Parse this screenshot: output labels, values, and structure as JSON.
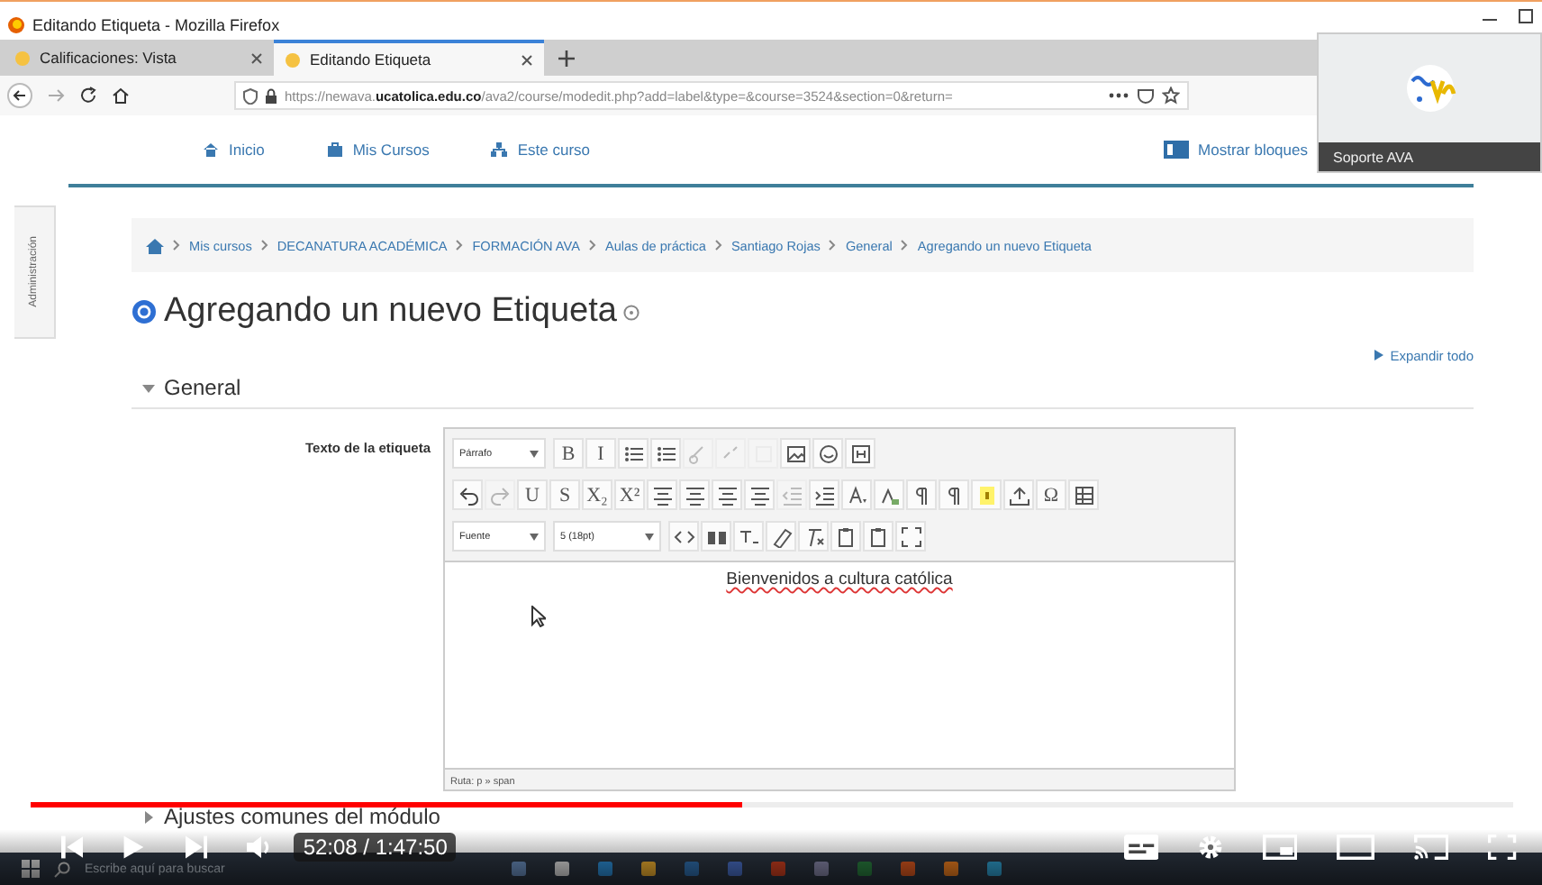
{
  "window": {
    "title": "Editando Etiqueta - Mozilla Firefox"
  },
  "tabs": [
    {
      "label": "Calificaciones: Vista",
      "selected": false
    },
    {
      "label": "Editando Etiqueta",
      "selected": true
    }
  ],
  "address_bar": {
    "url": "https://newava.**ucatolica.edu.co**/ava2/course/modedit.php?add=label&type=&course=3524&section=0&return="
  },
  "nav": {
    "items": [
      "Inicio",
      "Mis Cursos",
      "Este curso"
    ],
    "blocks_button": "Mostrar bloques"
  },
  "popup": {
    "label": "Soporte AVA"
  },
  "sidebar_tab": "Administración",
  "breadcrumb": [
    "Mis cursos",
    "DECANATURA ACADÉMICA",
    "FORMACIÓN AVA",
    "Aulas de práctica",
    "Santiago Rojas",
    "General",
    "Agregando un nuevo Etiqueta"
  ],
  "heading": "Agregando un nuevo Etiqueta",
  "expand_all": "Expandir todo",
  "section": {
    "title": "General",
    "expanded": true
  },
  "field_label": "Texto de la etiqueta",
  "editor": {
    "toolbar": [
      [
        {
          "kind": "select",
          "label": "Párrafo"
        },
        {
          "kind": "glyph",
          "text": "B",
          "disabled": false
        },
        {
          "kind": "glyph",
          "text": "I",
          "disabled": false
        },
        {
          "kind": "icon",
          "disabled": false
        },
        {
          "kind": "icon",
          "disabled": false
        },
        {
          "kind": "icon",
          "disabled": true
        },
        {
          "kind": "icon",
          "disabled": true
        },
        {
          "kind": "icon",
          "disabled": true
        },
        {
          "kind": "icon",
          "disabled": false
        },
        {
          "kind": "icon",
          "disabled": false
        },
        {
          "kind": "icon",
          "disabled": false
        }
      ],
      [
        {
          "kind": "icon",
          "disabled": false
        },
        {
          "kind": "icon",
          "disabled": true
        },
        {
          "kind": "glyph",
          "text": "U",
          "disabled": false
        },
        {
          "kind": "glyph",
          "text": "S",
          "disabled": false
        },
        {
          "kind": "glyph",
          "text": "X₂",
          "disabled": false
        },
        {
          "kind": "glyph",
          "text": "X²",
          "disabled": false
        },
        {
          "kind": "icon",
          "disabled": false
        },
        {
          "kind": "icon",
          "disabled": false
        },
        {
          "kind": "icon",
          "disabled": false
        },
        {
          "kind": "icon",
          "disabled": false
        },
        {
          "kind": "icon",
          "disabled": true
        },
        {
          "kind": "icon",
          "disabled": false
        },
        {
          "kind": "icon",
          "disabled": false
        },
        {
          "kind": "icon",
          "disabled": false
        },
        {
          "kind": "icon",
          "disabled": false
        },
        {
          "kind": "icon",
          "disabled": false
        },
        {
          "kind": "icon",
          "disabled": false
        },
        {
          "kind": "icon",
          "disabled": false
        },
        {
          "kind": "glyph",
          "text": "Ω",
          "disabled": false
        },
        {
          "kind": "icon",
          "disabled": false
        }
      ],
      [
        {
          "kind": "select",
          "label": "Fuente"
        },
        {
          "kind": "select",
          "label": "5 (18pt)"
        },
        {
          "kind": "icon",
          "disabled": false
        },
        {
          "kind": "icon",
          "disabled": false
        },
        {
          "kind": "icon",
          "disabled": false
        },
        {
          "kind": "icon",
          "disabled": false
        },
        {
          "kind": "icon",
          "disabled": false
        },
        {
          "kind": "icon",
          "disabled": false
        },
        {
          "kind": "icon",
          "disabled": false
        },
        {
          "kind": "icon",
          "disabled": false
        }
      ]
    ],
    "content": "Bienvenidos a cultura católica",
    "path": "Ruta: p » span"
  },
  "next_section": {
    "title": "Ajustes comunes del módulo",
    "expanded": false
  },
  "player": {
    "time": "52:08 / 1:47:50",
    "progress": {
      "level": 0.48
    }
  },
  "taskbar": {
    "search_placeholder": "Escribe aquí para buscar"
  }
}
